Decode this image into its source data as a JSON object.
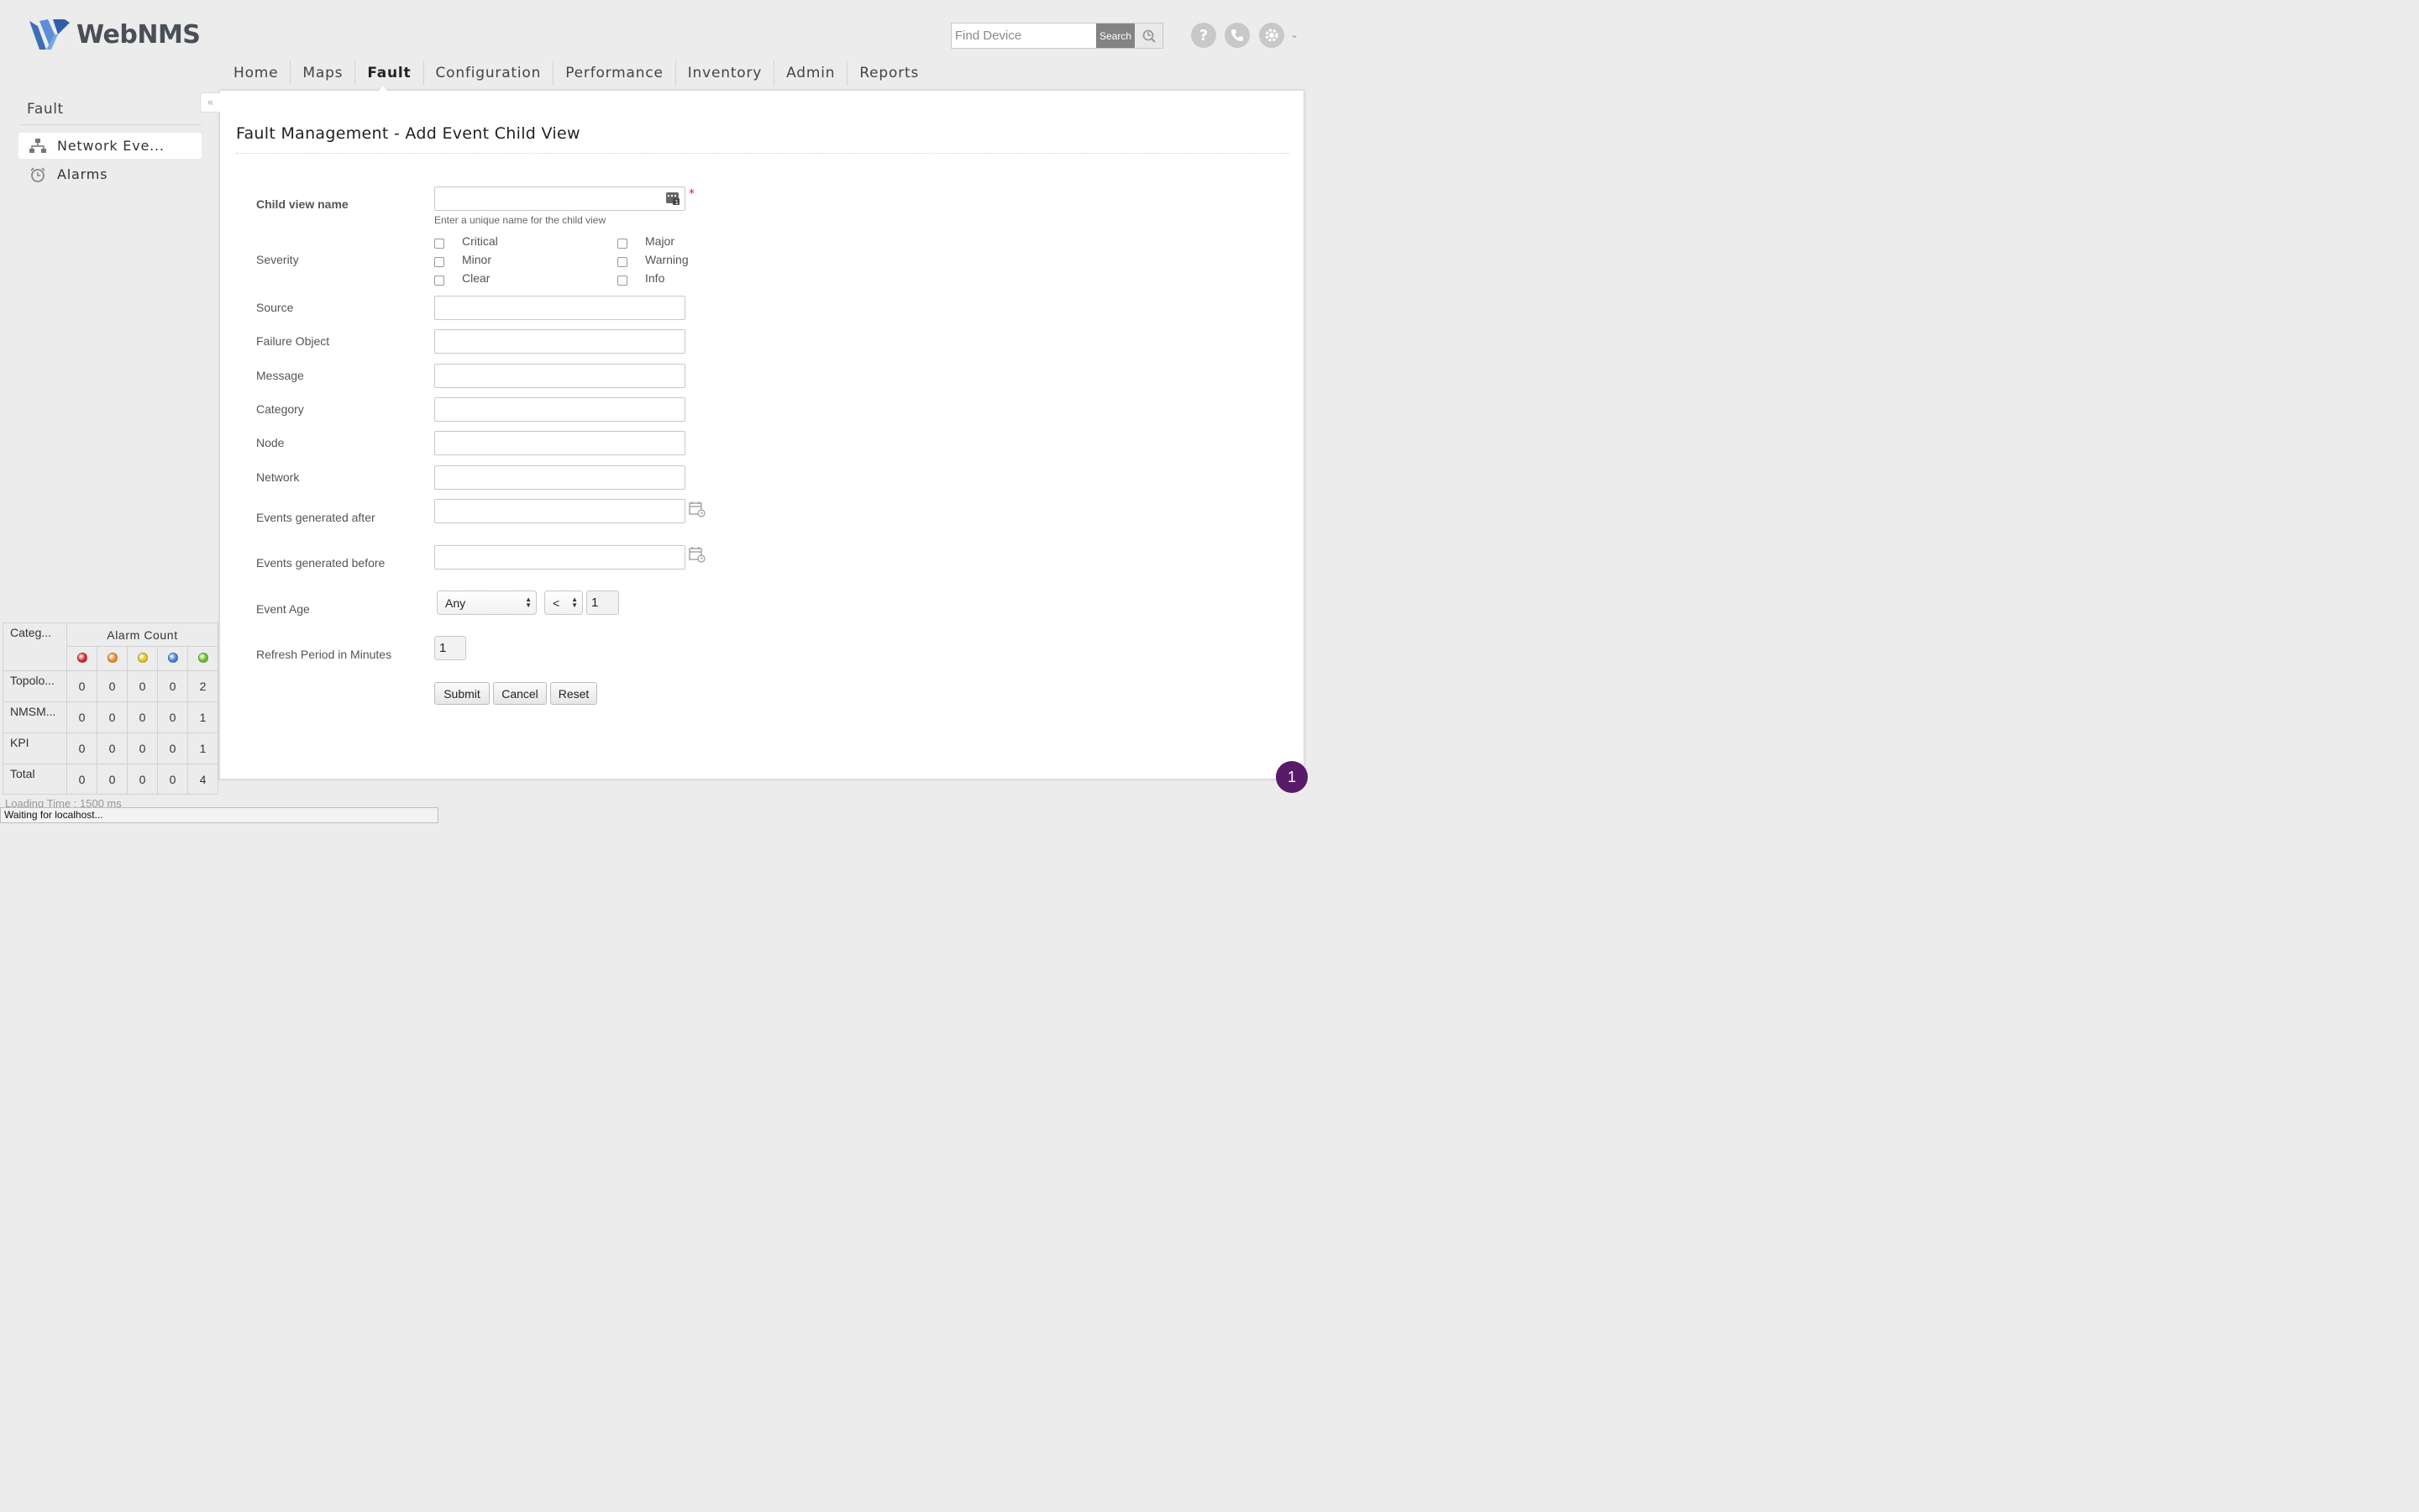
{
  "brand": {
    "name": "WebNMS"
  },
  "search": {
    "placeholder": "Find Device",
    "button_label": "Search"
  },
  "header_icons": [
    "help-icon",
    "phone-icon",
    "gear-icon",
    "chevron-down-icon"
  ],
  "nav": {
    "items": [
      {
        "label": "Home"
      },
      {
        "label": "Maps"
      },
      {
        "label": "Fault"
      },
      {
        "label": "Configuration"
      },
      {
        "label": "Performance"
      },
      {
        "label": "Inventory"
      },
      {
        "label": "Admin"
      },
      {
        "label": "Reports"
      }
    ],
    "active": "Fault"
  },
  "sidebar": {
    "title": "Fault",
    "items": [
      {
        "label": "Network Eve...",
        "icon": "network-icon",
        "selected": true
      },
      {
        "label": "Alarms",
        "icon": "alarm-clock-icon",
        "selected": false
      }
    ]
  },
  "alarm_summary": {
    "category_header": "Categ...",
    "count_header": "Alarm Count",
    "severity_colors": [
      "#d9262a",
      "#f08a24",
      "#e5c41a",
      "#3f7fe0",
      "#6cbf2e"
    ],
    "rows": [
      {
        "category": "Topolo...",
        "counts": [
          "0",
          "0",
          "0",
          "0",
          "2"
        ]
      },
      {
        "category": "NMSM...",
        "counts": [
          "0",
          "0",
          "0",
          "0",
          "1"
        ]
      },
      {
        "category": "KPI",
        "counts": [
          "0",
          "0",
          "0",
          "0",
          "1"
        ]
      },
      {
        "category": "Total",
        "counts": [
          "0",
          "0",
          "0",
          "0",
          "4"
        ]
      }
    ]
  },
  "status": {
    "loading_time": "Loading Time : 1500 ms",
    "browser_status": "Waiting for localhost..."
  },
  "form": {
    "title": "Fault Management - Add Event Child View",
    "child_view_name": {
      "label": "Child view name",
      "value": "",
      "hint": "Enter a unique name for the child view",
      "required_mark": "*"
    },
    "severity": {
      "label": "Severity",
      "options": [
        {
          "label": "Critical",
          "checked": false
        },
        {
          "label": "Major",
          "checked": false
        },
        {
          "label": "Minor",
          "checked": false
        },
        {
          "label": "Warning",
          "checked": false
        },
        {
          "label": "Clear",
          "checked": false
        },
        {
          "label": "Info",
          "checked": false
        }
      ]
    },
    "fields": [
      {
        "label": "Source",
        "value": ""
      },
      {
        "label": "Failure Object",
        "value": ""
      },
      {
        "label": "Message",
        "value": ""
      },
      {
        "label": "Category",
        "value": ""
      },
      {
        "label": "Node",
        "value": ""
      },
      {
        "label": "Network",
        "value": ""
      }
    ],
    "generated_after": {
      "label": "Events generated after",
      "value": ""
    },
    "generated_before": {
      "label": "Events generated before",
      "value": ""
    },
    "event_age": {
      "label": "Event Age",
      "scope": "Any",
      "operator": "<",
      "value": "1"
    },
    "refresh_period": {
      "label": "Refresh Period in Minutes",
      "value": "1"
    },
    "buttons": {
      "submit": "Submit",
      "cancel": "Cancel",
      "reset": "Reset"
    }
  },
  "notification_badge": "1"
}
